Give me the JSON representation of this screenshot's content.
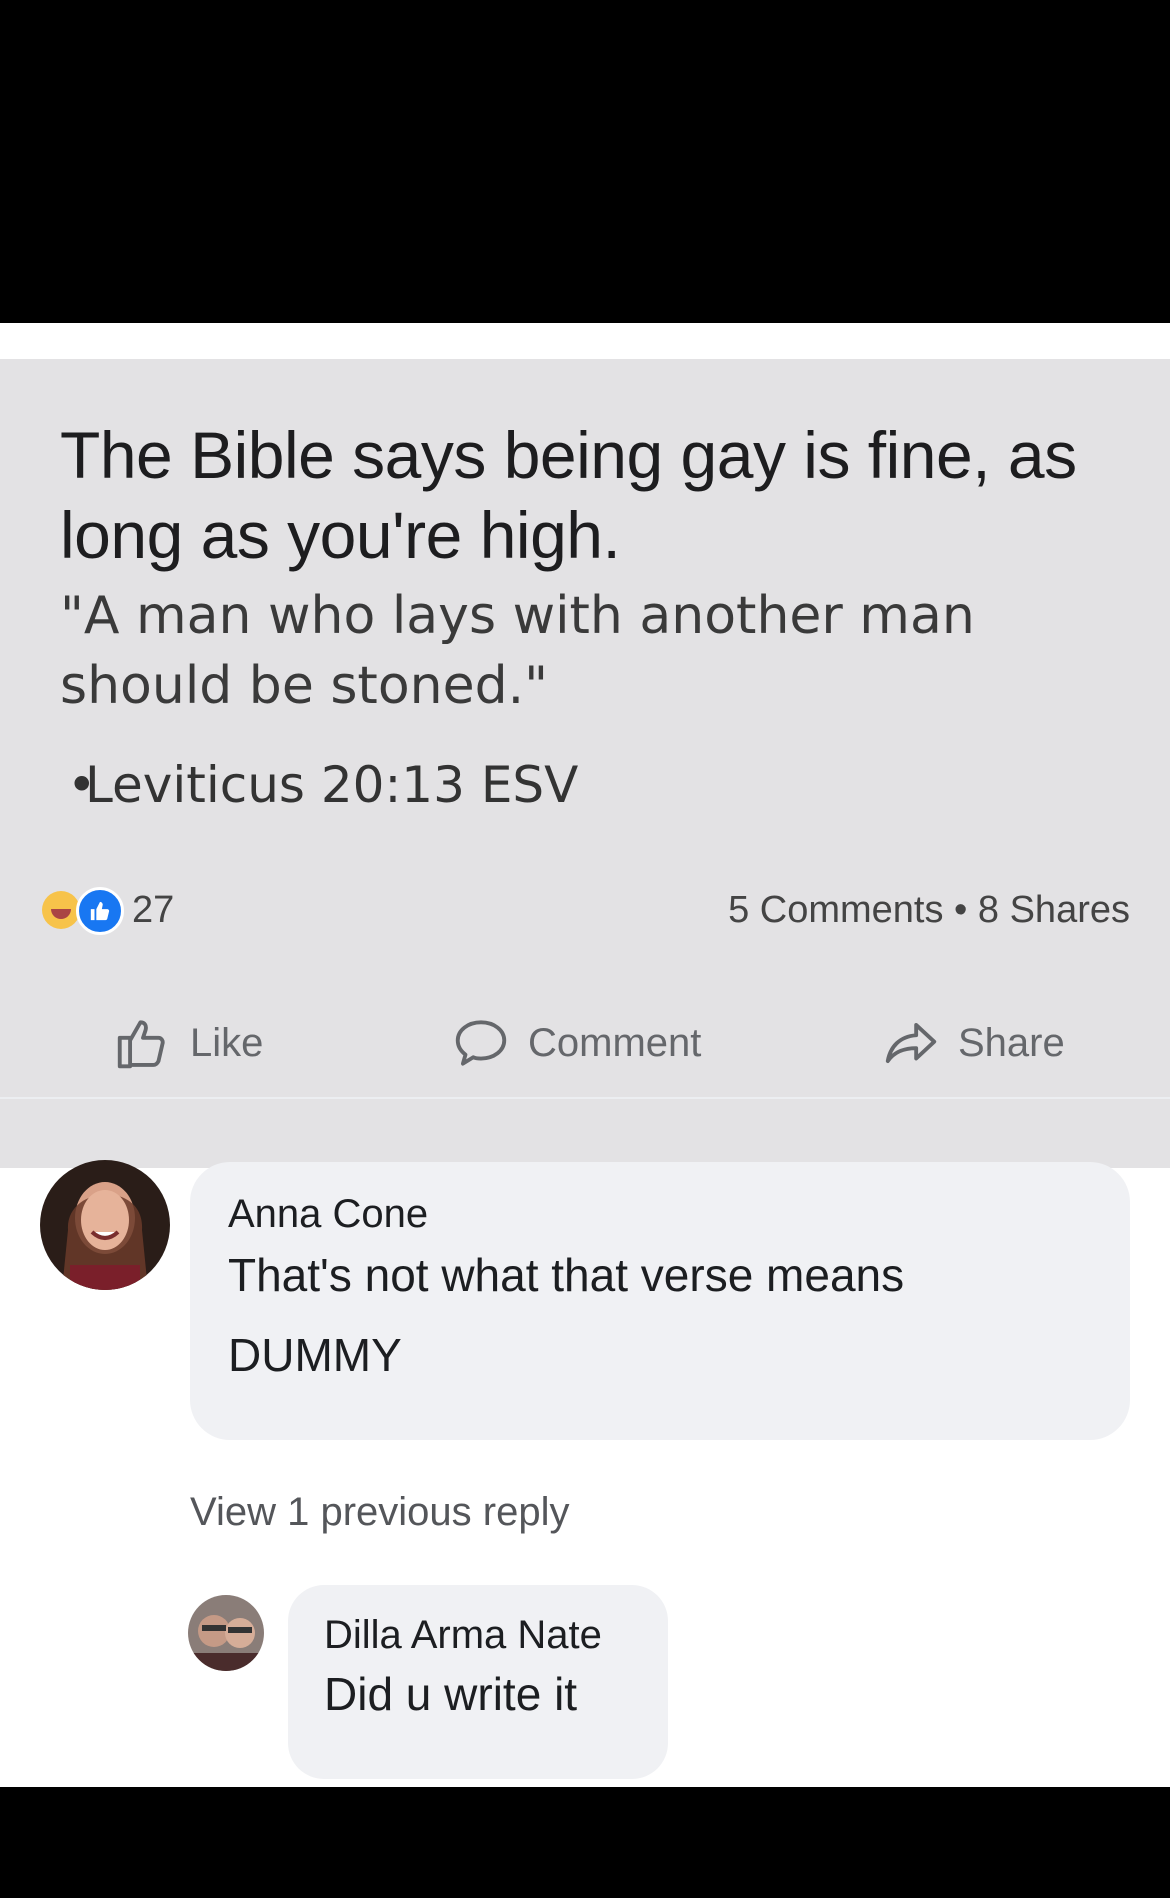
{
  "post": {
    "headline": "The Bible says being gay is fine, as long as you're high.",
    "quote": "\"A man who lays with another man should be stoned.\"",
    "citation_bullet": "•",
    "citation": "Leviticus 20:13 ESV"
  },
  "reactions": {
    "icons": [
      "haha-icon",
      "like-icon"
    ],
    "count": "27",
    "stats": "5 Comments • 8 Shares"
  },
  "actions": {
    "like": "Like",
    "comment": "Comment",
    "share": "Share"
  },
  "comments": [
    {
      "author": "Anna Cone",
      "text_line1": "That's not what that verse means",
      "text_line2": "DUMMY"
    }
  ],
  "view_replies": "View 1 previous reply",
  "replies": [
    {
      "author": "Dilla Arma Nate",
      "text": "Did u write it"
    }
  ],
  "colors": {
    "card_background": "#e3e2e4",
    "bubble_background": "#f0f1f4",
    "like_blue": "#1877f2",
    "muted_text": "#65676b"
  }
}
